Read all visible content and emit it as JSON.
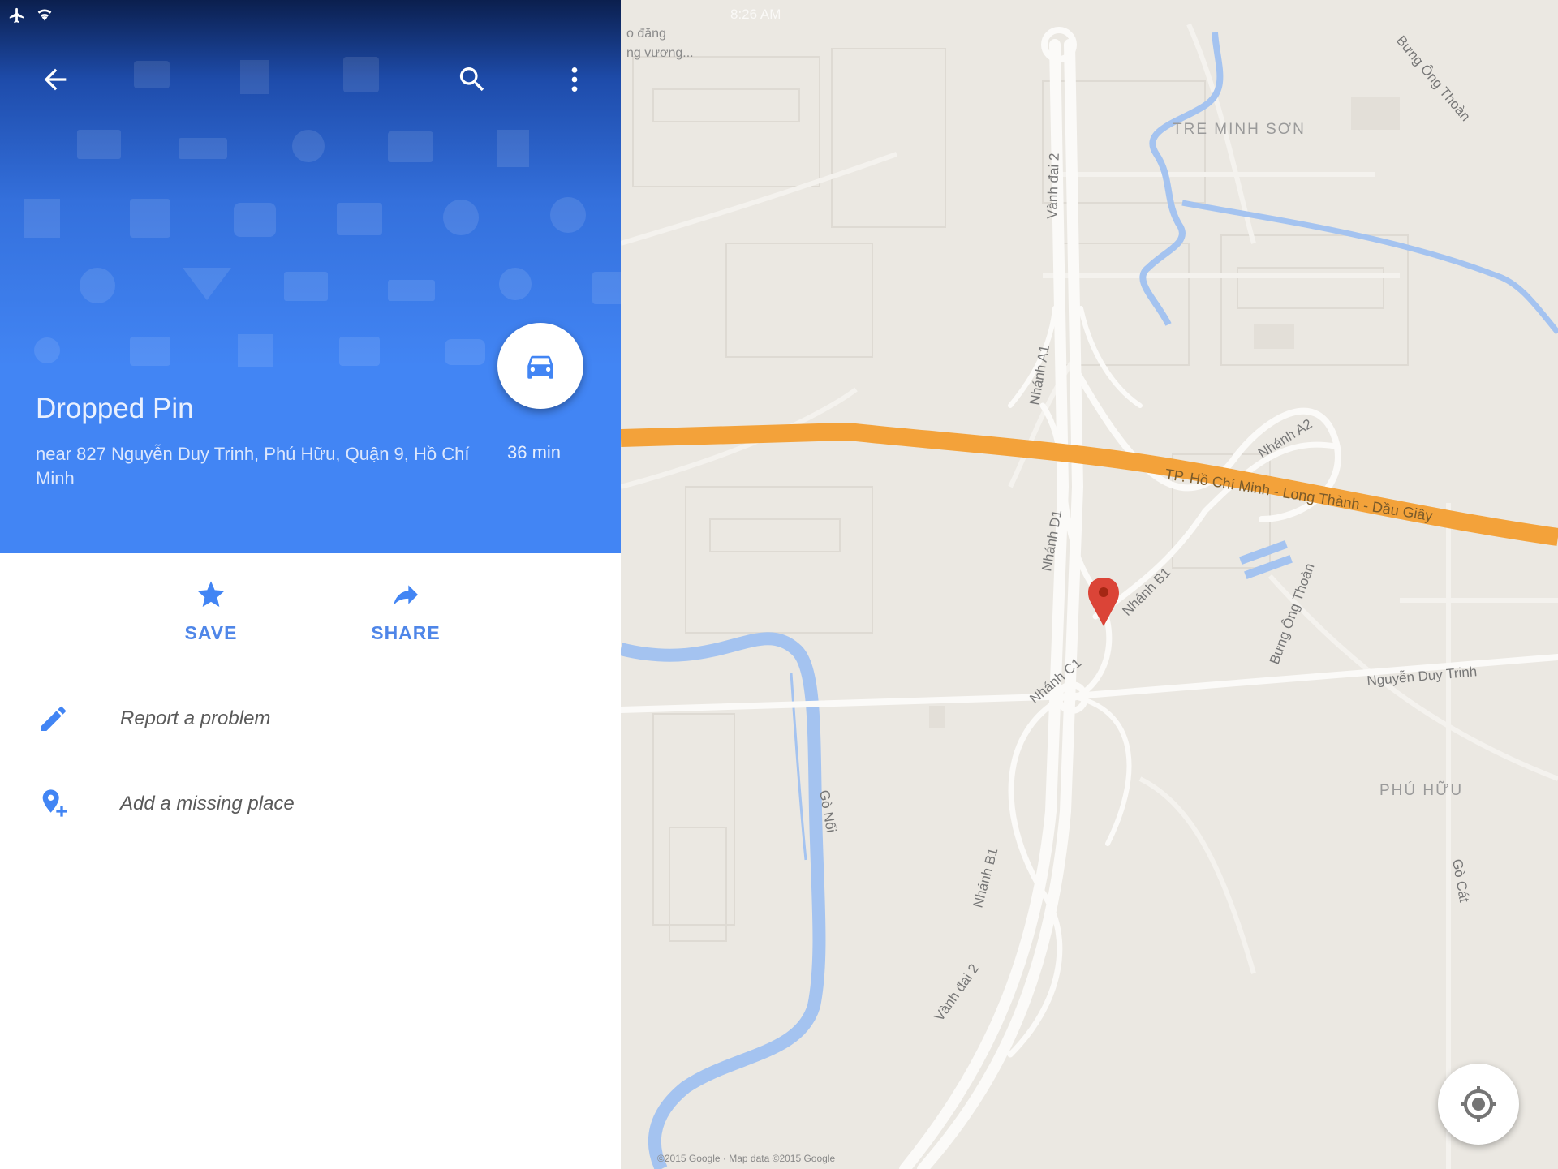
{
  "status_bar": {
    "right_text": "8:26 AM"
  },
  "toolbar": {
    "back_icon": "arrow-back-icon",
    "search_icon": "search-icon",
    "more_icon": "more-vert-icon"
  },
  "place": {
    "title": "Dropped Pin",
    "address": "near 827 Nguyễn Duy Trinh, Phú Hữu, Quận 9, Hồ Chí Minh",
    "eta": "36 min",
    "directions_icon": "car-icon"
  },
  "actions": [
    {
      "label": "SAVE",
      "icon": "star-icon"
    },
    {
      "label": "SHARE",
      "icon": "share-arrow-icon"
    }
  ],
  "menu": [
    {
      "label": "Report a problem",
      "icon": "pencil-icon"
    },
    {
      "label": "Add a missing place",
      "icon": "add-place-icon"
    }
  ],
  "map": {
    "labels": {
      "vanh_dai_2_top": "Vành đai 2",
      "vanh_dai_2_bottom": "Vành đai 2",
      "nhanh_a1": "Nhánh A1",
      "nhanh_a2": "Nhánh A2",
      "nhanh_b1": "Nhánh B1",
      "nhanh_b1_lower": "Nhánh B1",
      "nhanh_d1": "Nhánh D1",
      "nhanh_c1": "Nhánh C1",
      "highway": "TP. Hồ Chí Minh - Long Thành - Dầu Giây",
      "nguyen_duy_trinh": "Nguyễn Duy Trinh",
      "bung_ong_thoan_top": "Bưng Ông Thoàn",
      "bung_ong_thoan_mid": "Bưng Ông Thoàn",
      "tre_minh_son": "TRE MINH SƠN",
      "phu_huu": "PHÚ HỮU",
      "go_noi": "Gò Nổi",
      "go_cat": "Gò Cát",
      "corner_line1": "o đăng",
      "corner_line2": "ng vương..."
    },
    "attribution": "©2015 Google · Map data ©2015 Google",
    "locate_icon": "my-location-icon",
    "pin_icon": "map-pin-icon",
    "colors": {
      "highway": "#f3a23a",
      "water": "#a4c3f0",
      "pin": "#db4437",
      "road": "#fbfaf8"
    }
  }
}
